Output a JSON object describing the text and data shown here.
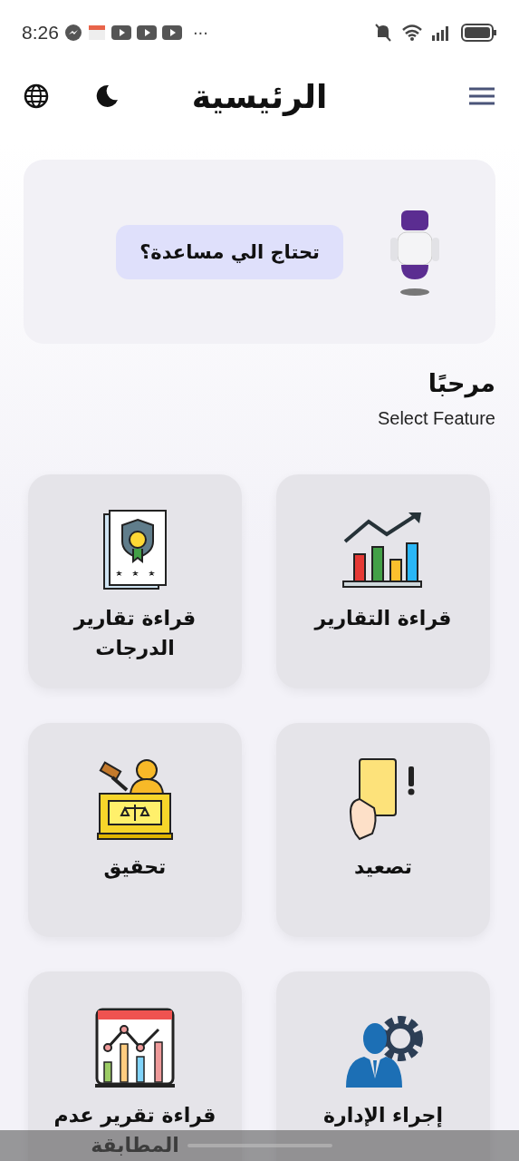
{
  "status_bar": {
    "time": "8:26",
    "more": "···"
  },
  "header": {
    "title": "الرئيسية"
  },
  "assistant": {
    "prompt": "تحتاج الي مساعدة؟"
  },
  "greeting": "مرحبًا",
  "subtitle": "Select Feature",
  "features": [
    {
      "label": "قراءة التقارير"
    },
    {
      "label": "قراءة تقارير الدرجات"
    },
    {
      "label": "تصعيد"
    },
    {
      "label": "تحقيق"
    },
    {
      "label": "إجراء الإدارة"
    },
    {
      "label": "قراءة تقرير عدم المطابقة"
    }
  ]
}
